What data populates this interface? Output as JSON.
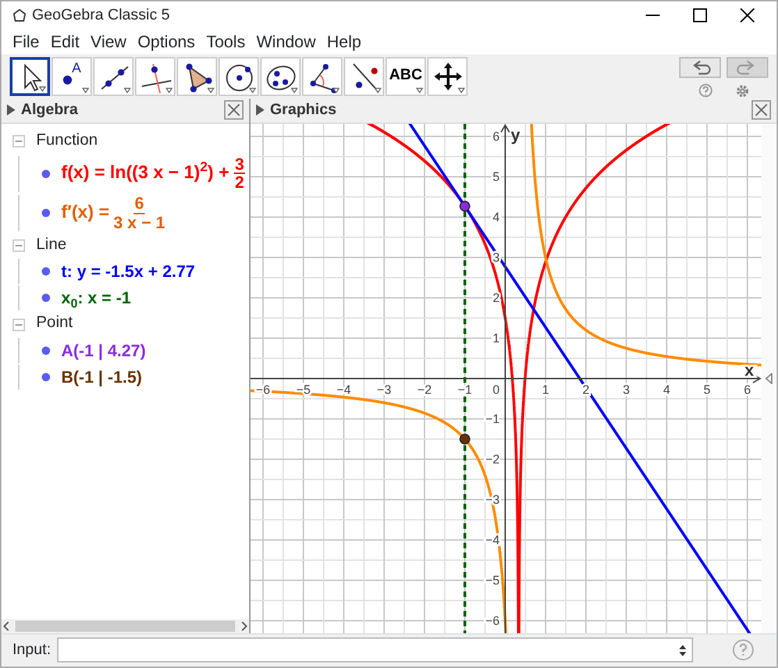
{
  "window": {
    "title": "GeoGebra Classic 5"
  },
  "menu": [
    "File",
    "Edit",
    "View",
    "Options",
    "Tools",
    "Window",
    "Help"
  ],
  "toolbar": {
    "tools": [
      {
        "kind": "move",
        "selected": true
      },
      {
        "kind": "point",
        "label": "A",
        "selected": false
      },
      {
        "kind": "line",
        "selected": false
      },
      {
        "kind": "perpendicular",
        "selected": false
      },
      {
        "kind": "polygon",
        "selected": false
      },
      {
        "kind": "circle",
        "selected": false
      },
      {
        "kind": "conic",
        "selected": false
      },
      {
        "kind": "angle",
        "selected": false
      },
      {
        "kind": "reflect",
        "selected": false
      },
      {
        "kind": "text",
        "label": "ABC",
        "selected": false
      },
      {
        "kind": "move-view",
        "selected": false
      }
    ],
    "undo": {
      "disabled": false
    },
    "redo": {
      "disabled": true
    }
  },
  "algebra": {
    "title": "Algebra",
    "groups": [
      {
        "label": "Function",
        "items": [
          {
            "kind": "fraction",
            "lhs": "f(x) = ln((3 x − 1)$^{2}$) +",
            "numerator": "3",
            "denominator": "2",
            "color": "#ff0000"
          },
          {
            "kind": "fraction",
            "lhs": "f′(x) =",
            "numerator": "6",
            "denominator": "3 x − 1",
            "color": "#e06000"
          }
        ]
      },
      {
        "label": "Line",
        "items": [
          {
            "kind": "text",
            "text": "t: y = -1.5x + 2.77",
            "color": "#0000ff"
          },
          {
            "kind": "text",
            "text": "x$_{0}$: x = -1",
            "color": "#006400"
          }
        ]
      },
      {
        "label": "Point",
        "items": [
          {
            "kind": "text",
            "text": "A(-1 | 4.27)",
            "color": "#8a2be2"
          },
          {
            "kind": "text",
            "text": "B(-1 | -1.5)",
            "color": "#663300"
          }
        ]
      }
    ]
  },
  "graphics": {
    "title": "Graphics",
    "x_axis_label": "x",
    "y_axis_label": "y",
    "origin_label": "0",
    "x_tick_labels": [
      "−6",
      "−5",
      "−4",
      "−3",
      "−2",
      "−1",
      "1",
      "2",
      "3",
      "4",
      "5",
      "6"
    ],
    "y_tick_labels": [
      "6",
      "5",
      "4",
      "3",
      "2",
      "1",
      "−1",
      "−2",
      "−3",
      "−4",
      "−5",
      "−6"
    ]
  },
  "input": {
    "label": "Input:"
  }
}
